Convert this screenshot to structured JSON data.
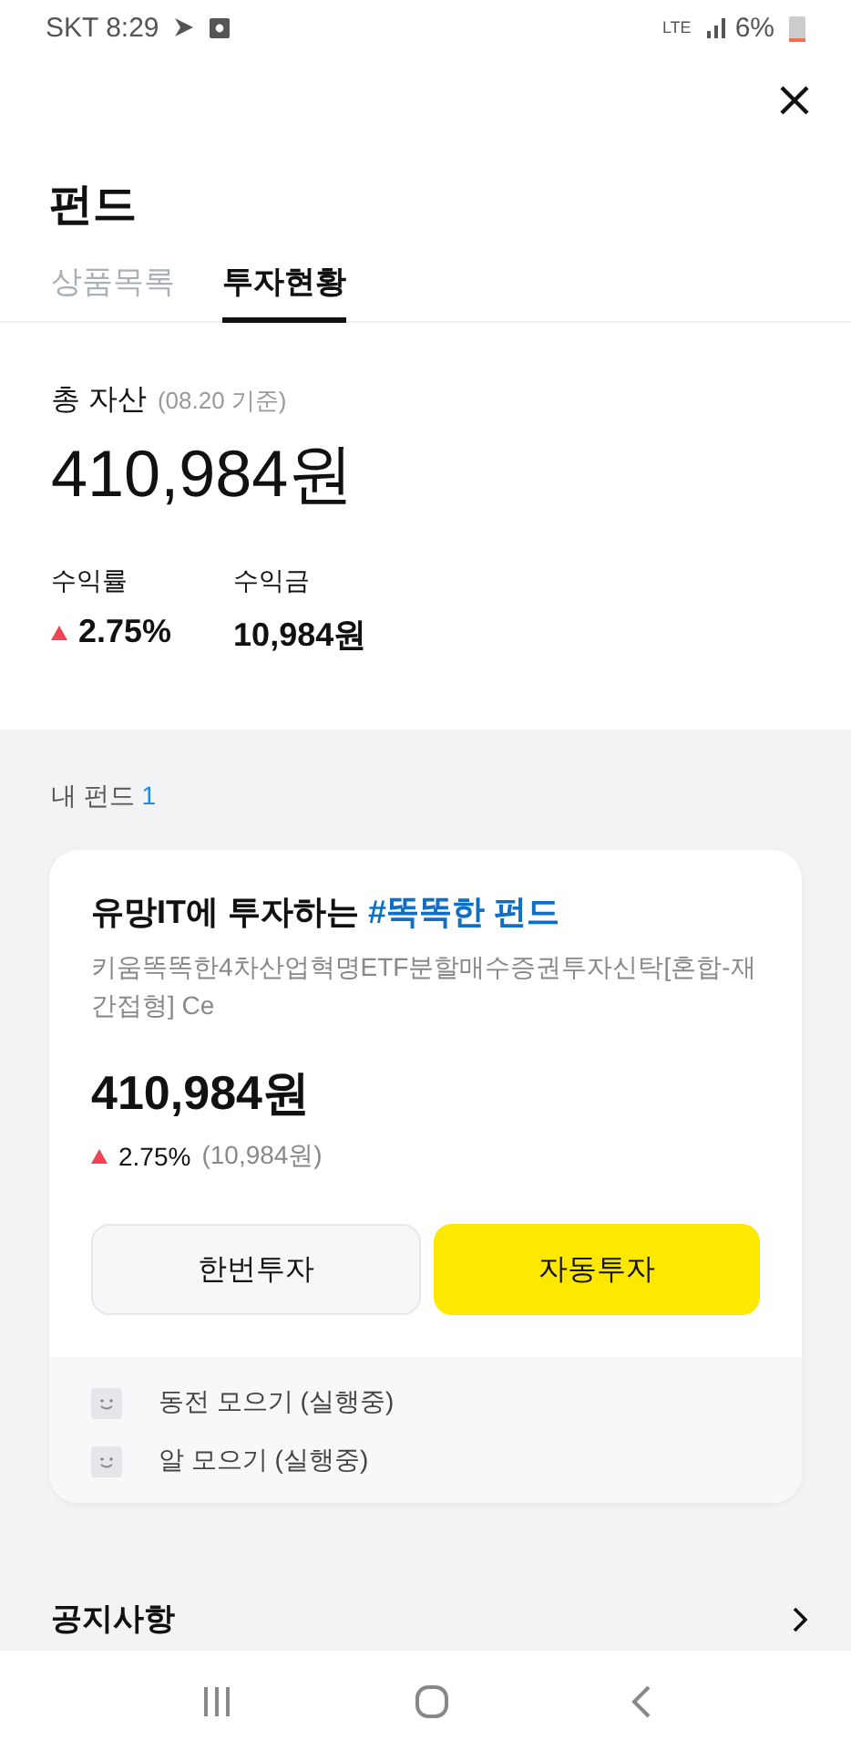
{
  "status_bar": {
    "carrier_time": "SKT 8:29",
    "network": "LTE",
    "battery": "6%"
  },
  "header": {
    "title": "펀드"
  },
  "tabs": [
    {
      "label": "상품목록",
      "selected": false
    },
    {
      "label": "투자현황",
      "selected": true
    }
  ],
  "summary": {
    "label": "총 자산",
    "date": "(08.20 기준)",
    "total": "410,984원",
    "return_rate_label": "수익률",
    "return_rate": "2.75%",
    "return_up": true,
    "profit_label": "수익금",
    "profit": "10,984원"
  },
  "my_funds": {
    "label": "내 펀드",
    "count": "1"
  },
  "fund_card": {
    "title": "유망IT에 투자하는 **#똑똑한 펀드**",
    "name": "키움똑똑한4차산업혁명ETF분할매수증권투자신탁[혼합-재간접형] Ce",
    "amount": "410,984원",
    "change_up": true,
    "change_rate": "2.75%",
    "change_amount": "(10,984원)",
    "buttons": [
      {
        "label": "한번투자",
        "kind": "secondary"
      },
      {
        "label": "자동투자",
        "kind": "primary"
      }
    ],
    "plans": [
      {
        "label": "동전 모으기 (실행중)"
      },
      {
        "label": "알 모으기 (실행중)"
      }
    ]
  },
  "notice": {
    "label": "공지사항"
  }
}
